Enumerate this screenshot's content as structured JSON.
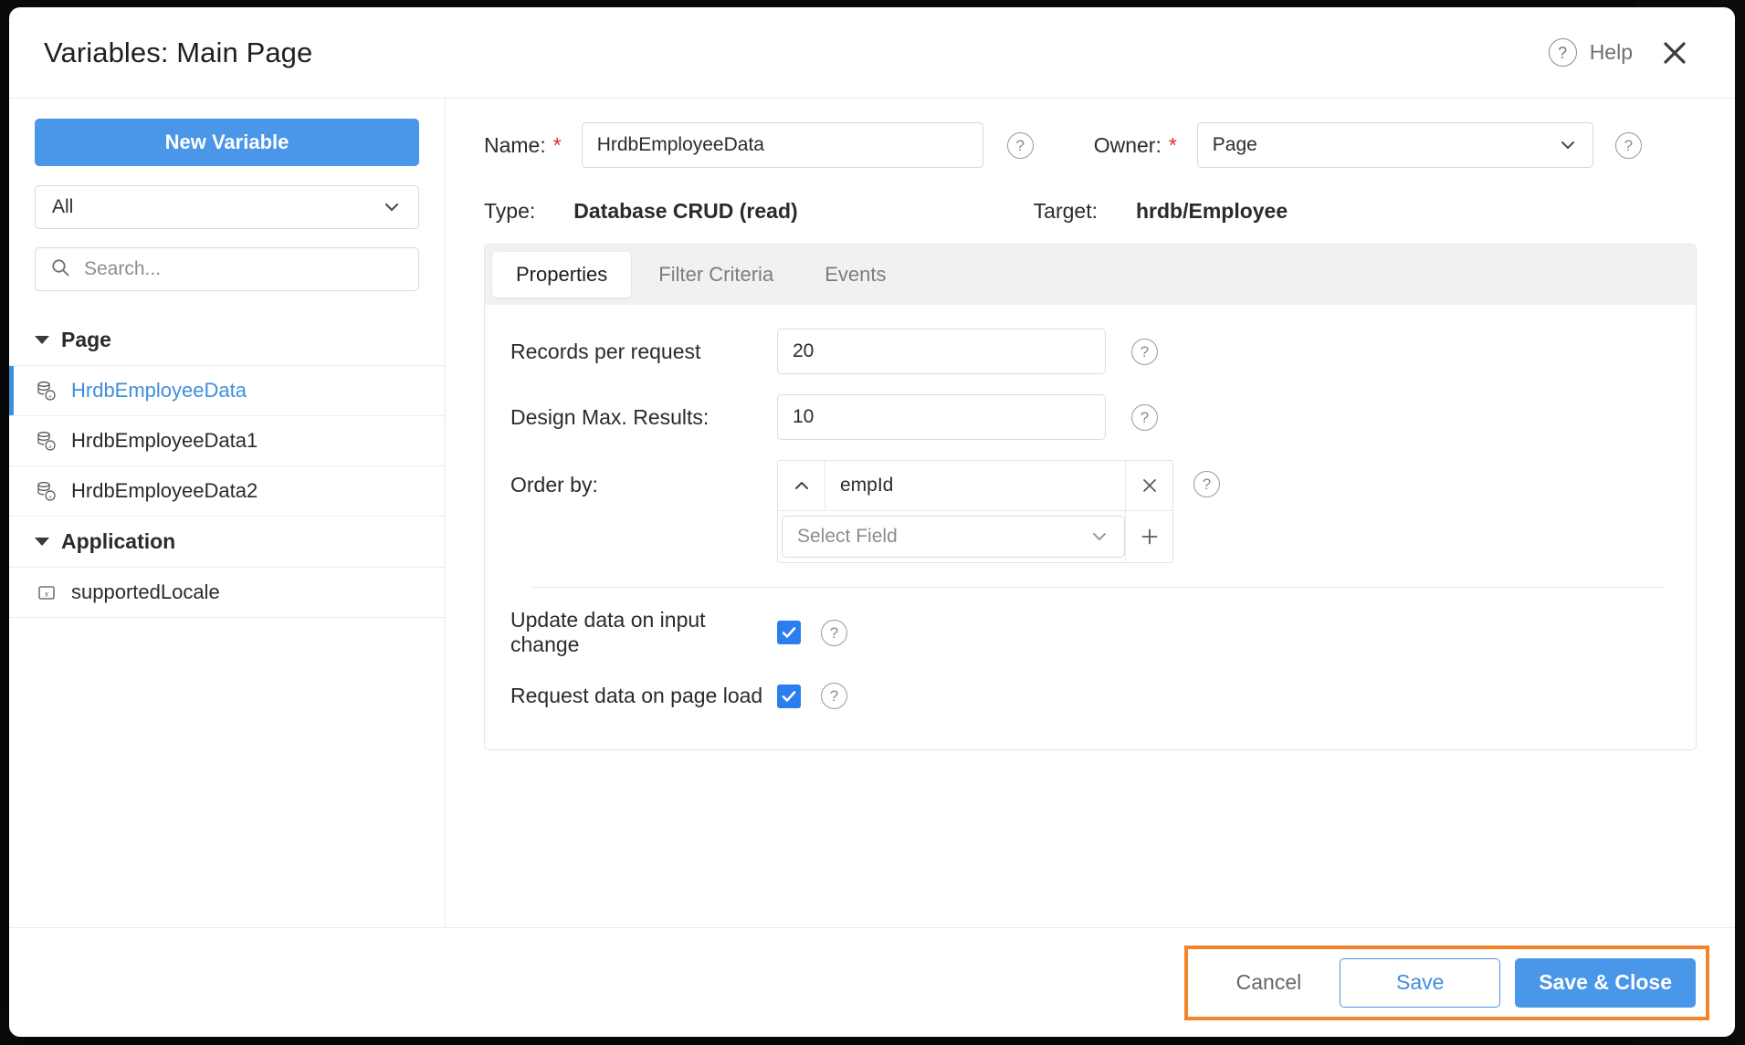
{
  "header": {
    "title": "Variables: Main Page",
    "help_label": "Help",
    "help_icon": "question-circle-icon",
    "close_icon": "close-icon"
  },
  "sidebar": {
    "new_variable_label": "New Variable",
    "filter_value": "All",
    "search_placeholder": "Search...",
    "search_value": "",
    "search_icon": "search-icon",
    "groups": [
      {
        "label": "Page",
        "items": [
          {
            "label": "HrdbEmployeeData",
            "icon": "database-variable-icon",
            "selected": true
          },
          {
            "label": "HrdbEmployeeData1",
            "icon": "database-variable-icon",
            "selected": false
          },
          {
            "label": "HrdbEmployeeData2",
            "icon": "database-variable-icon",
            "selected": false
          }
        ]
      },
      {
        "label": "Application",
        "items": [
          {
            "label": "supportedLocale",
            "icon": "scalar-variable-icon",
            "selected": false
          }
        ]
      }
    ]
  },
  "form": {
    "name_label": "Name:",
    "name_value": "HrdbEmployeeData",
    "name_placeholder": "",
    "owner_label": "Owner:",
    "owner_value": "Page",
    "type_label": "Type:",
    "type_value": "Database CRUD (read)",
    "target_label": "Target:",
    "target_value": "hrdb/Employee",
    "required_marker": "*"
  },
  "tabs": [
    {
      "label": "Properties",
      "active": true
    },
    {
      "label": "Filter Criteria",
      "active": false
    },
    {
      "label": "Events",
      "active": false
    }
  ],
  "properties": {
    "records_per_request_label": "Records per request",
    "records_per_request_value": "20",
    "design_max_results_label": "Design Max. Results:",
    "design_max_results_value": "10",
    "order_by_label": "Order by:",
    "order_by_direction_icon": "chevron-up-icon",
    "order_by_field": "empId",
    "order_by_remove_icon": "close-icon",
    "order_by_select_placeholder": "Select Field",
    "order_by_add_icon": "plus-icon",
    "update_on_input_change_label": "Update data on input change",
    "update_on_input_change_checked": true,
    "request_on_page_load_label": "Request data on page load",
    "request_on_page_load_checked": true
  },
  "footer": {
    "cancel_label": "Cancel",
    "save_label": "Save",
    "save_close_label": "Save & Close",
    "highlight_color": "#f4842a"
  },
  "colors": {
    "accent": "#4a96e8",
    "link": "#3f8fdd",
    "required": "#d93025",
    "checkbox": "#2a7ef0",
    "highlight": "#f4842a"
  }
}
